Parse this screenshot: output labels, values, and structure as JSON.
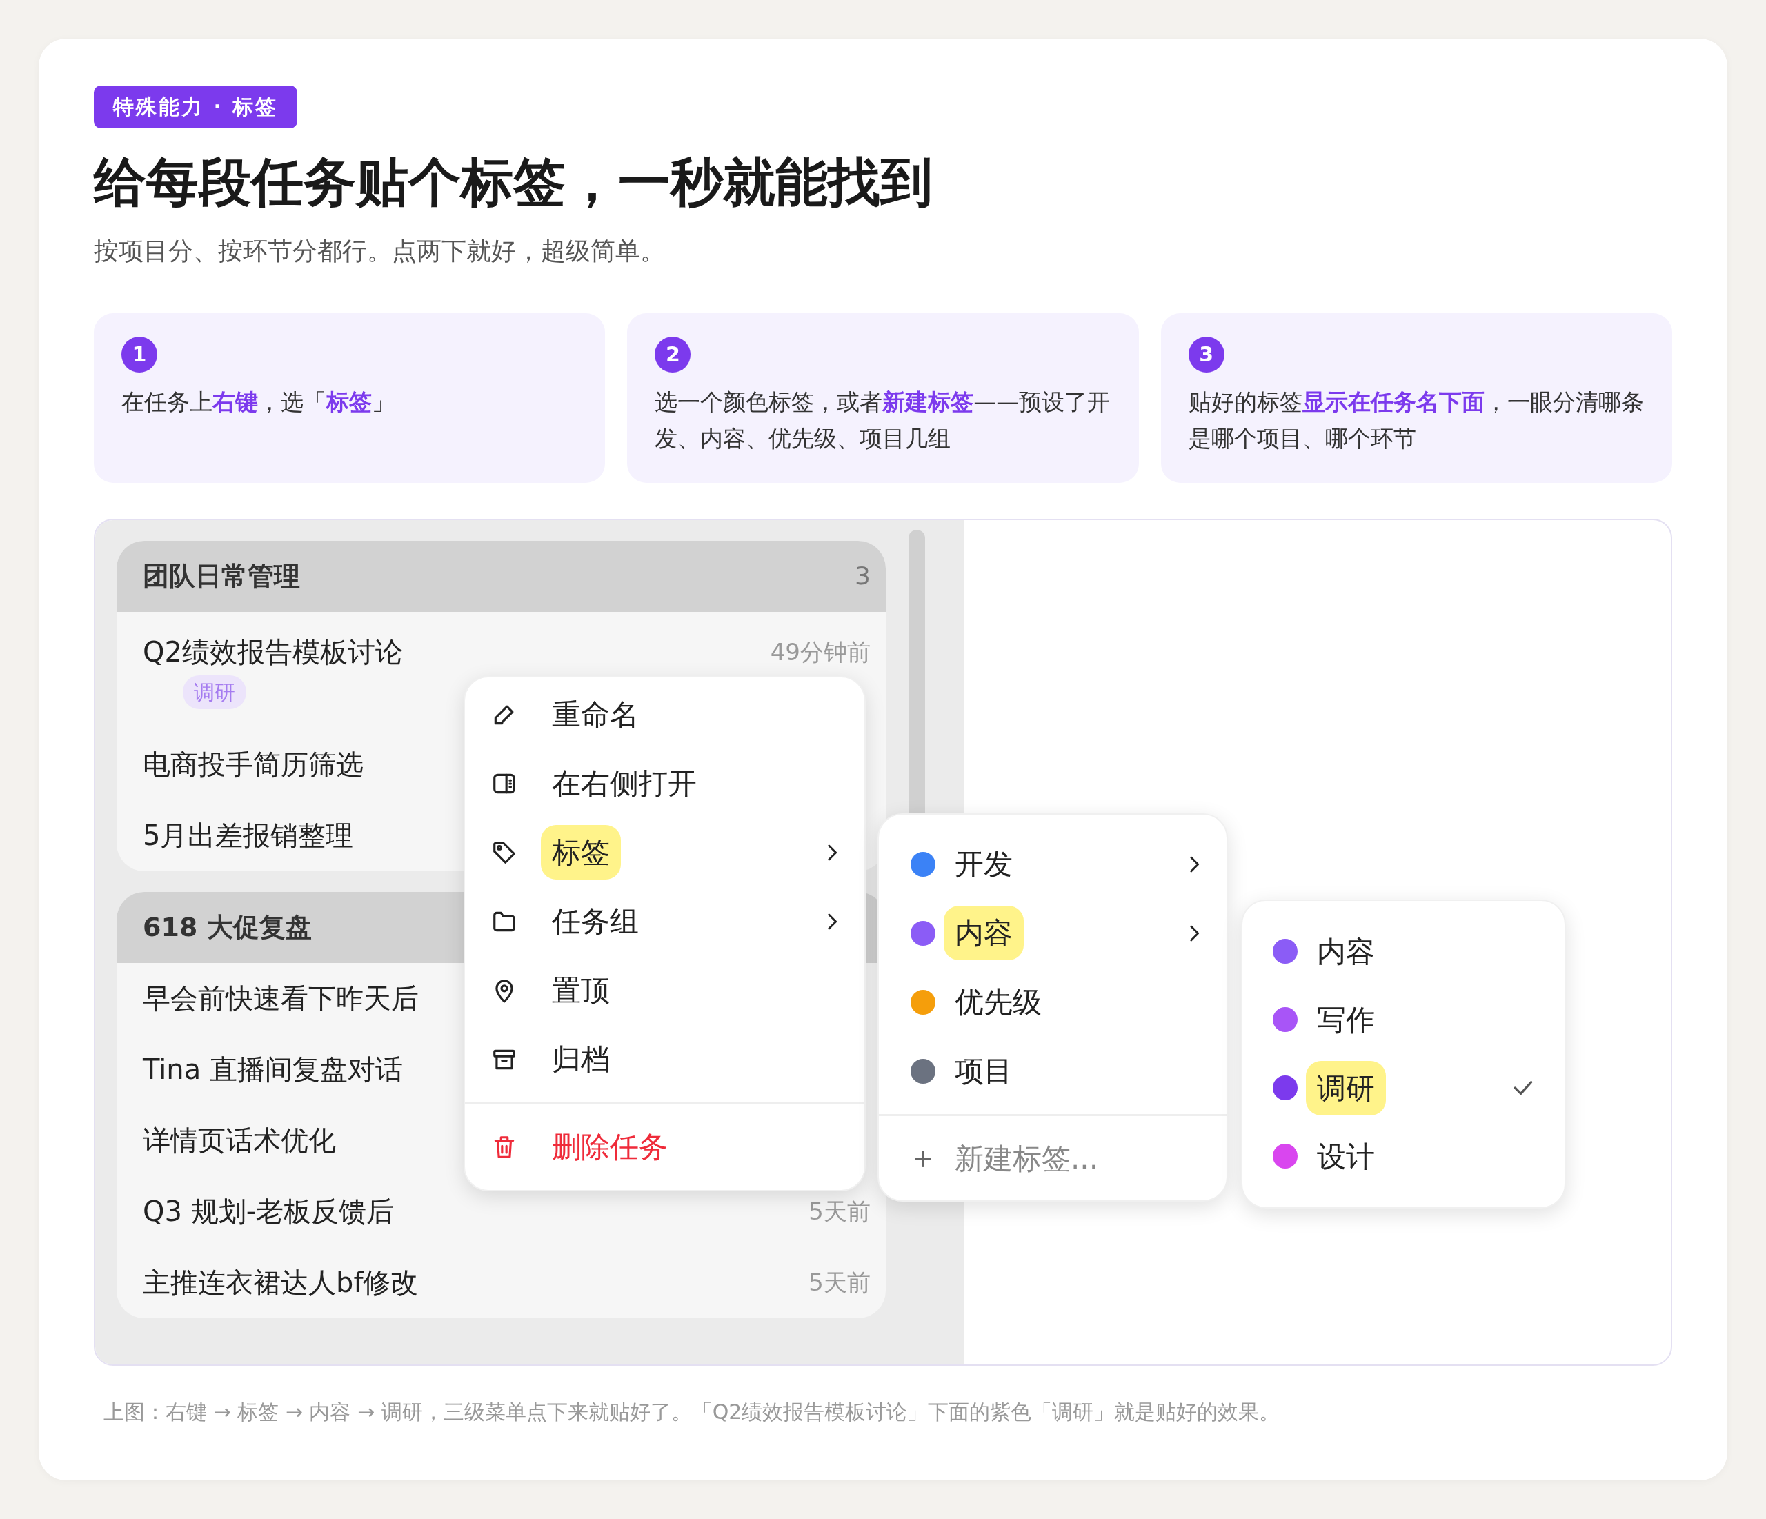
{
  "badge": "特殊能力 · 标签",
  "title": "给每段任务贴个标签，一秒就能找到",
  "subtitle": "按项目分、按环节分都行。点两下就好，超级简单。",
  "steps": [
    {
      "number": "1",
      "text": "在任务上**右键**，选「**标签**」"
    },
    {
      "number": "2",
      "text": "选一个颜色标签，或者**新建标签**——预设了开发、内容、优先级、项目几组"
    },
    {
      "number": "3",
      "text": "贴好的标签**显示在任务名下面**，一眼分清哪条是哪个项目、哪个环节"
    }
  ],
  "task_groups": [
    {
      "name": "团队日常管理",
      "count": "3",
      "tasks": [
        {
          "title": "Q2绩效报告模板讨论",
          "time": "49分钟前",
          "tags": [
            "调研"
          ]
        },
        {
          "title": "电商投手简历筛选"
        },
        {
          "title": "5月出差报销整理"
        }
      ]
    },
    {
      "name": "618 大促复盘",
      "tasks": [
        {
          "title": "早会前快速看下昨天后"
        },
        {
          "title": "Tina 直播间复盘对话"
        },
        {
          "title": "详情页话术优化"
        },
        {
          "title": "Q3 规划-老板反馈后",
          "time": "5天前"
        },
        {
          "title": "主推连衣裙达人bf修改",
          "time": "5天前"
        }
      ]
    }
  ],
  "context_menu": {
    "items": [
      {
        "label": "重命名",
        "kind": "action",
        "submenu": false,
        "selected": false
      },
      {
        "label": "在右侧打开",
        "kind": "action",
        "submenu": false,
        "selected": false
      },
      {
        "label": "标签",
        "kind": "action",
        "submenu": true,
        "selected": true
      },
      {
        "label": "任务组",
        "kind": "action",
        "submenu": true,
        "selected": false
      },
      {
        "label": "置顶",
        "kind": "action",
        "submenu": false,
        "selected": false
      },
      {
        "label": "归档",
        "kind": "action",
        "submenu": false,
        "selected": false
      },
      {
        "label": "删除任务",
        "kind": "danger",
        "submenu": false,
        "selected": false
      }
    ]
  },
  "tag_menu": {
    "items": [
      {
        "label": "开发",
        "color": "#3b82f6",
        "submenu": true,
        "selected": false
      },
      {
        "label": "内容",
        "color": "#8b5cf6",
        "submenu": true,
        "selected": true
      },
      {
        "label": "优先级",
        "color": "#f59e0b",
        "submenu": false,
        "selected": false
      },
      {
        "label": "项目",
        "color": "#6b7280",
        "submenu": false,
        "selected": false
      }
    ],
    "new_tag": "新建标签..."
  },
  "tag_submenu": {
    "items": [
      {
        "label": "内容",
        "color": "#8b5cf6",
        "selected": false,
        "checked": false
      },
      {
        "label": "写作",
        "color": "#a855f7",
        "selected": false,
        "checked": false
      },
      {
        "label": "调研",
        "color": "#7c3aed",
        "selected": true,
        "checked": true
      },
      {
        "label": "设计",
        "color": "#d946ef",
        "selected": false,
        "checked": false
      }
    ]
  },
  "caption": "上图：右键 → 标签 → 内容 → 调研，三级菜单点下来就贴好了。「Q2绩效报告模板讨论」下面的紫色「调研」就是贴好的效果。"
}
